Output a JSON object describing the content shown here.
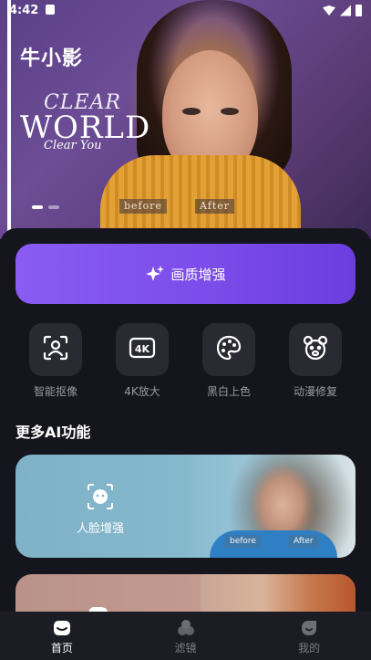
{
  "status_bar": {
    "time": "4:42"
  },
  "hero": {
    "app_title": "牛小影",
    "headline_1": "CLEAR",
    "headline_2": "WORLD",
    "headline_3": "Clear You",
    "before_label": "before",
    "after_label": "After",
    "carousel_index": 1,
    "carousel_total": 2
  },
  "primary_action": {
    "label": "画质增强",
    "icon": "sparkle-icon"
  },
  "tools": [
    {
      "label": "智能抠像",
      "icon": "portrait-scan-icon"
    },
    {
      "label": "4K放大",
      "icon": "4k-icon"
    },
    {
      "label": "黑白上色",
      "icon": "palette-icon"
    },
    {
      "label": "动漫修复",
      "icon": "bear-face-icon"
    }
  ],
  "more_section": {
    "title": "更多AI功能",
    "cards": [
      {
        "label": "人脸增强",
        "icon": "face-enhance-icon",
        "before_label": "before",
        "after_label": "After"
      }
    ]
  },
  "bottom_nav": [
    {
      "label": "首页",
      "icon": "home-icon",
      "active": true
    },
    {
      "label": "滤镜",
      "icon": "filter-icon",
      "active": false
    },
    {
      "label": "我的",
      "icon": "profile-icon",
      "active": false
    }
  ],
  "colors": {
    "background": "#15151d",
    "accent_start": "#8a5cf5",
    "accent_end": "#6c3ddf",
    "tool_tile": "#2a2a33",
    "nav_bg": "#1c1c25"
  }
}
